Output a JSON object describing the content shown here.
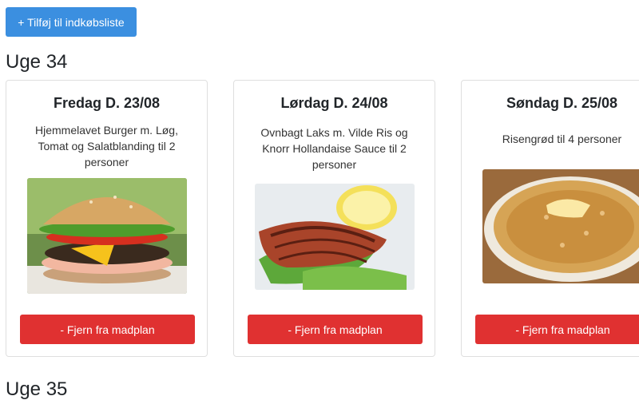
{
  "toolbar": {
    "add_label": "+ Tilføj til indkøbsliste"
  },
  "weeks": [
    {
      "title": "Uge 34",
      "days": [
        {
          "day": "Fredag D. 23/08",
          "description": "Hjemmelavet Burger m. Løg, Tomat og Salatblanding til 2 personer",
          "image": "burger",
          "remove_label": "- Fjern fra madplan"
        },
        {
          "day": "Lørdag D. 24/08",
          "description": "Ovnbagt Laks m. Vilde Ris og Knorr Hollandaise Sauce til 2 personer",
          "image": "salmon",
          "remove_label": "- Fjern fra madplan"
        },
        {
          "day": "Søndag D. 25/08",
          "description": "Risengrød til 4 personer",
          "image": "rice-porridge",
          "remove_label": "- Fjern fra madplan"
        }
      ]
    },
    {
      "title": "Uge 35",
      "days": []
    }
  ],
  "colors": {
    "primary": "#3b8fe0",
    "danger": "#e03131",
    "border": "#dfdfdf"
  }
}
